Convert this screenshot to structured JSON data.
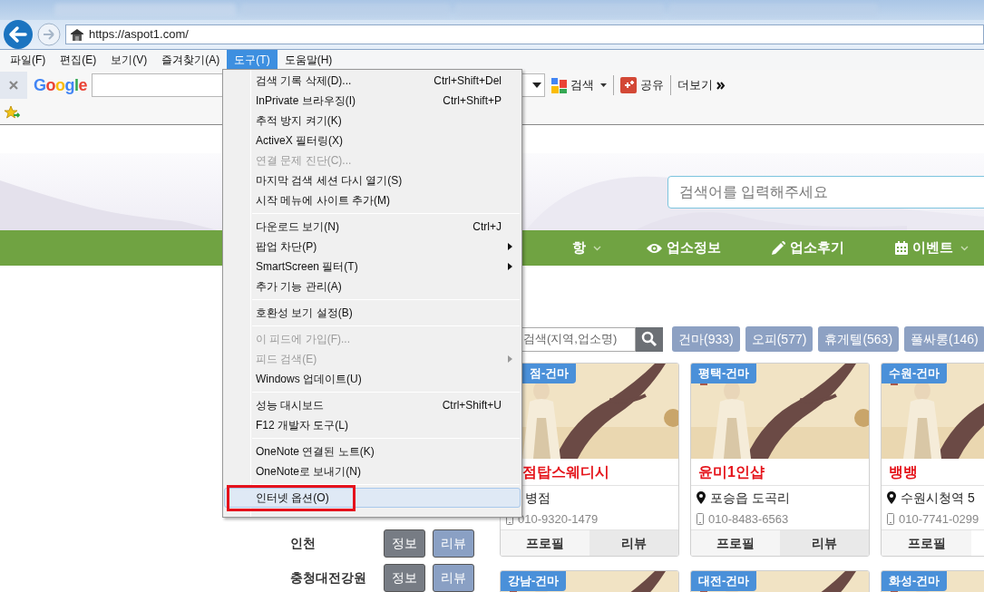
{
  "address_bar": {
    "url": "https://aspot1.com/"
  },
  "menu_bar": [
    {
      "label": "파일(F)",
      "selected": false
    },
    {
      "label": "편집(E)",
      "selected": false
    },
    {
      "label": "보기(V)",
      "selected": false
    },
    {
      "label": "즐겨찾기(A)",
      "selected": false
    },
    {
      "label": "도구(T)",
      "selected": true
    },
    {
      "label": "도움말(H)",
      "selected": false
    }
  ],
  "google_toolbar": {
    "logo": "Google",
    "buttons": [
      {
        "kind": "search",
        "label": "검색"
      },
      {
        "kind": "share",
        "label": "공유"
      },
      {
        "kind": "more",
        "label": "더보기"
      }
    ]
  },
  "site": {
    "search": {
      "placeholder": "검색어를 입력해주세요"
    },
    "nav": [
      {
        "label": "항",
        "kind": "plain",
        "dropdown": true
      },
      {
        "label": "업소정보",
        "kind": "eye",
        "dropdown": false
      },
      {
        "label": "업소후기",
        "kind": "pencil",
        "dropdown": false
      },
      {
        "label": "이벤트",
        "kind": "calendar",
        "dropdown": true
      }
    ],
    "regions": [
      {
        "name": "인천",
        "buttons": [
          "정보",
          "리뷰"
        ]
      },
      {
        "name": "충청대전강원",
        "buttons": [
          "정보",
          "리뷰"
        ]
      }
    ],
    "shop_search": {
      "placeholder": "검색(지역,업소명)"
    },
    "categories": [
      "건마(933)",
      "오피(577)",
      "휴게텔(563)",
      "풀싸롱(146)"
    ],
    "cards": [
      {
        "badge": "점-건마",
        "title": "점탑스웨디시",
        "location": "병점",
        "phone": "010-9320-1479",
        "buttons": [
          "프로필",
          "리뷰"
        ]
      },
      {
        "badge": "평택-건마",
        "title": "윤미1인샵",
        "location": "포승읍 도곡리",
        "phone": "010-8483-6563",
        "buttons": [
          "프로필",
          "리뷰"
        ]
      },
      {
        "badge": "수원-건마",
        "title": "뱅뱅",
        "location": "수원시청역 5",
        "phone": "010-7741-0299",
        "buttons": [
          "프로필"
        ]
      }
    ],
    "more_cards": [
      {
        "badge": "강남-건마"
      },
      {
        "badge": "대전-건마"
      },
      {
        "badge": "화성-건마"
      }
    ]
  },
  "tools_menu": {
    "groups": [
      [
        {
          "label": "검색 기록 삭제(D)...",
          "shortcut": "Ctrl+Shift+Del",
          "disabled": false,
          "submenu": false,
          "selected": false,
          "outlined": false
        },
        {
          "label": "InPrivate 브라우징(I)",
          "shortcut": "Ctrl+Shift+P",
          "disabled": false,
          "submenu": false,
          "selected": false,
          "outlined": false
        },
        {
          "label": "추적 방지 켜기(K)",
          "disabled": false,
          "submenu": false,
          "selected": false,
          "outlined": false
        },
        {
          "label": "ActiveX 필터링(X)",
          "disabled": false,
          "submenu": false,
          "selected": false,
          "outlined": false
        },
        {
          "label": "연결 문제 진단(C)...",
          "disabled": true,
          "submenu": false,
          "selected": false,
          "outlined": false
        },
        {
          "label": "마지막 검색 세션 다시 열기(S)",
          "disabled": false,
          "submenu": false,
          "selected": false,
          "outlined": false
        },
        {
          "label": "시작 메뉴에 사이트 추가(M)",
          "disabled": false,
          "submenu": false,
          "selected": false,
          "outlined": false
        }
      ],
      [
        {
          "label": "다운로드 보기(N)",
          "shortcut": "Ctrl+J",
          "disabled": false,
          "submenu": false,
          "selected": false,
          "outlined": false
        },
        {
          "label": "팝업 차단(P)",
          "disabled": false,
          "submenu": true,
          "selected": false,
          "outlined": false
        },
        {
          "label": "SmartScreen 필터(T)",
          "disabled": false,
          "submenu": true,
          "selected": false,
          "outlined": false
        },
        {
          "label": "추가 기능 관리(A)",
          "disabled": false,
          "submenu": false,
          "selected": false,
          "outlined": false
        }
      ],
      [
        {
          "label": "호환성 보기 설정(B)",
          "disabled": false,
          "submenu": false,
          "selected": false,
          "outlined": false
        }
      ],
      [
        {
          "label": "이 피드에 가입(F)...",
          "disabled": true,
          "submenu": false,
          "selected": false,
          "outlined": false
        },
        {
          "label": "피드 검색(E)",
          "disabled": true,
          "submenu": true,
          "selected": false,
          "outlined": false
        },
        {
          "label": "Windows 업데이트(U)",
          "disabled": false,
          "submenu": false,
          "selected": false,
          "outlined": false
        }
      ],
      [
        {
          "label": "성능 대시보드",
          "shortcut": "Ctrl+Shift+U",
          "disabled": false,
          "submenu": false,
          "selected": false,
          "outlined": false
        },
        {
          "label": "F12 개발자 도구(L)",
          "disabled": false,
          "submenu": false,
          "selected": false,
          "outlined": false
        }
      ],
      [
        {
          "label": "OneNote 연결된 노트(K)",
          "disabled": false,
          "submenu": false,
          "selected": false,
          "outlined": false
        },
        {
          "label": "OneNote로 보내기(N)",
          "disabled": false,
          "submenu": false,
          "selected": false,
          "outlined": false
        }
      ],
      [
        {
          "label": "인터넷 옵션(O)",
          "disabled": false,
          "submenu": false,
          "selected": true,
          "outlined": true
        }
      ]
    ]
  }
}
